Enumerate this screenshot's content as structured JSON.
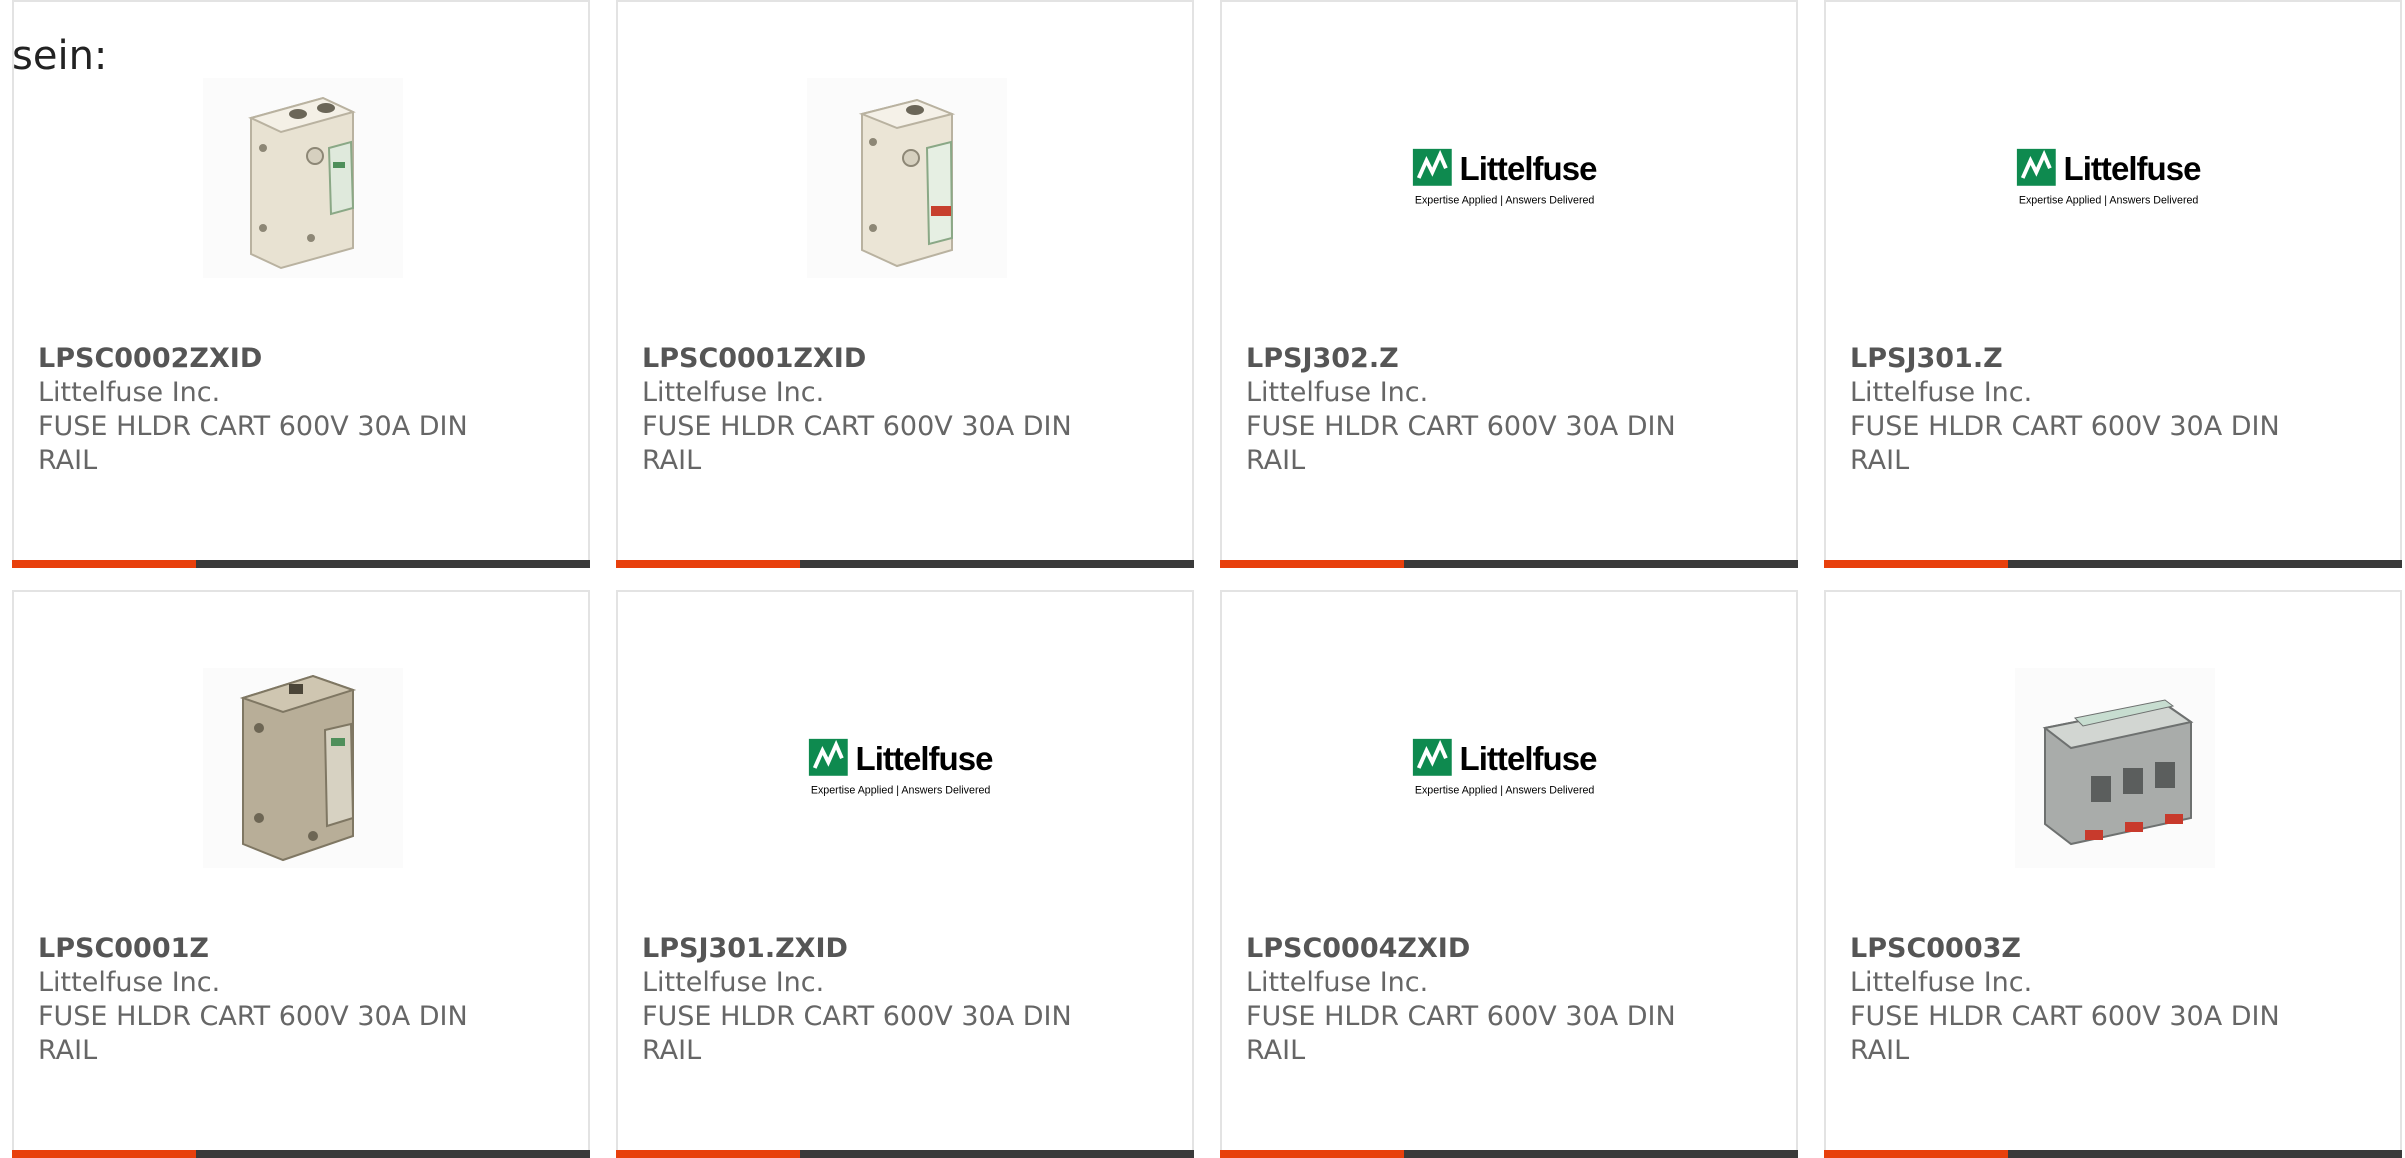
{
  "intro_text": "sein:",
  "brand": {
    "name": "Littelfuse",
    "tagline": "Expertise Applied | Answers Delivered",
    "accent_color": "#e8400c",
    "bar_color": "#3a3a3a",
    "logo_color": "#0e8a4f"
  },
  "products": [
    {
      "part": "LPSC0002ZXID",
      "manufacturer": "Littelfuse Inc.",
      "description": "FUSE HLDR CART 600V 30A DIN RAIL",
      "image": "fuse-holder-photo"
    },
    {
      "part": "LPSC0001ZXID",
      "manufacturer": "Littelfuse Inc.",
      "description": "FUSE HLDR CART 600V 30A DIN RAIL",
      "image": "fuse-holder-photo"
    },
    {
      "part": "LPSJ302.Z",
      "manufacturer": "Littelfuse Inc.",
      "description": "FUSE HLDR CART 600V 30A DIN RAIL",
      "image": "littelfuse-logo"
    },
    {
      "part": "LPSJ301.Z",
      "manufacturer": "Littelfuse Inc.",
      "description": "FUSE HLDR CART 600V 30A DIN RAIL",
      "image": "littelfuse-logo"
    },
    {
      "part": "LPSC0001Z",
      "manufacturer": "Littelfuse Inc.",
      "description": "FUSE HLDR CART 600V 30A DIN RAIL",
      "image": "fuse-holder-photo"
    },
    {
      "part": "LPSJ301.ZXID",
      "manufacturer": "Littelfuse Inc.",
      "description": "FUSE HLDR CART 600V 30A DIN RAIL",
      "image": "littelfuse-logo"
    },
    {
      "part": "LPSC0004ZXID",
      "manufacturer": "Littelfuse Inc.",
      "description": "FUSE HLDR CART 600V 30A DIN RAIL",
      "image": "littelfuse-logo"
    },
    {
      "part": "LPSC0003Z",
      "manufacturer": "Littelfuse Inc.",
      "description": "FUSE HLDR CART 600V 30A DIN RAIL",
      "image": "fuse-holder-3pole-photo"
    }
  ]
}
